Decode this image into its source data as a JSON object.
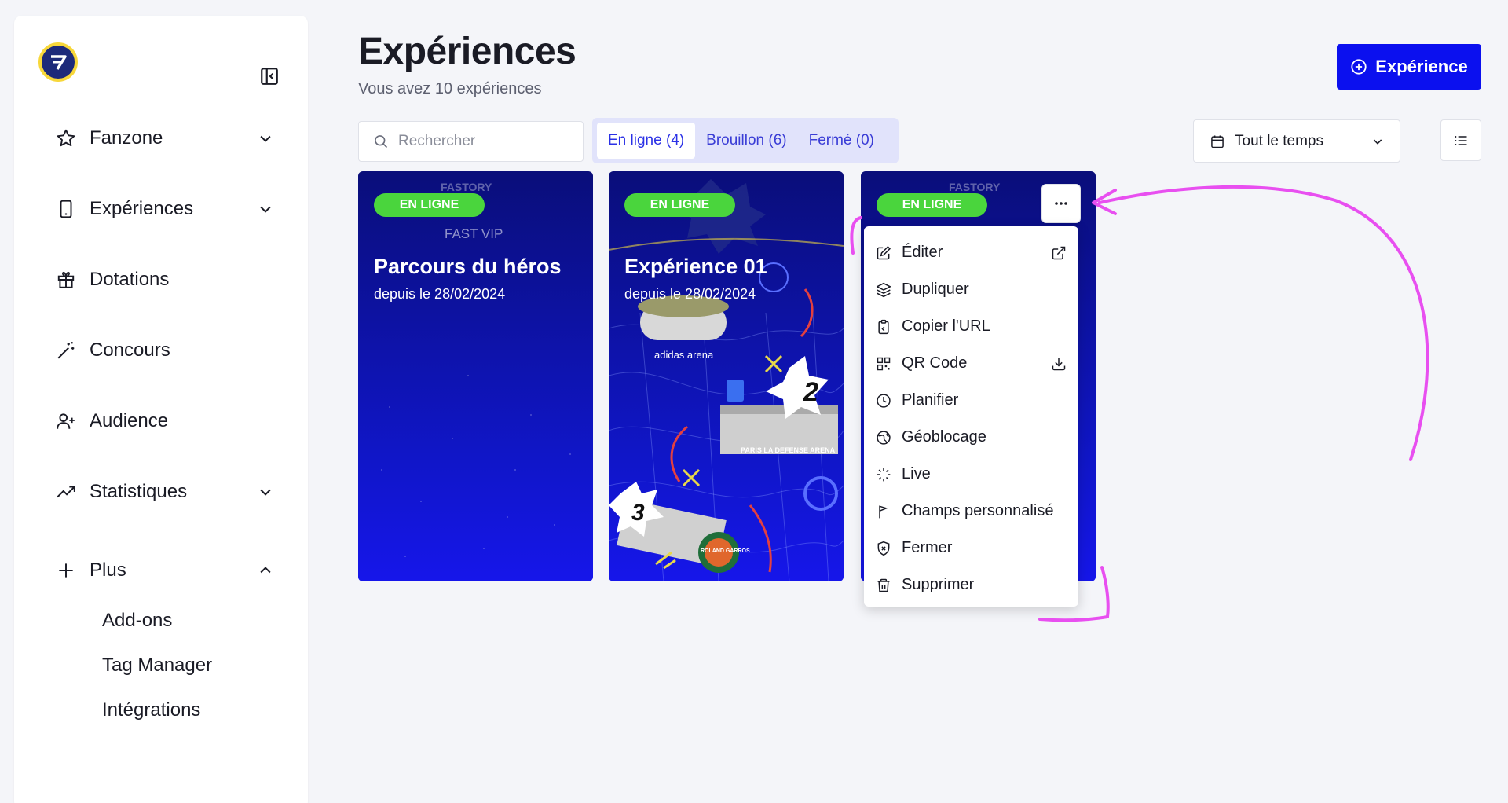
{
  "sidebar": {
    "items": [
      {
        "label": "Fanzone",
        "icon": "star-icon",
        "expandable": true
      },
      {
        "label": "Expériences",
        "icon": "smartphone-icon",
        "expandable": true
      },
      {
        "label": "Dotations",
        "icon": "gift-icon",
        "expandable": false
      },
      {
        "label": "Concours",
        "icon": "magic-wand-icon",
        "expandable": false
      },
      {
        "label": "Audience",
        "icon": "user-plus-icon",
        "expandable": false
      },
      {
        "label": "Statistiques",
        "icon": "trending-up-icon",
        "expandable": true
      },
      {
        "label": "Plus",
        "icon": "plus-icon",
        "expandable": true
      }
    ],
    "sub_items": [
      "Add-ons",
      "Tag Manager",
      "Intégrations"
    ]
  },
  "header": {
    "title": "Expériences",
    "subtitle": "Vous avez 10 expériences",
    "new_button": "Expérience"
  },
  "filters": {
    "search_placeholder": "Rechercher",
    "tabs": [
      "En ligne (4)",
      "Brouillon (6)",
      "Fermé (0)"
    ],
    "active_tab": "En ligne (4)",
    "date_range": "Tout le temps"
  },
  "cards": [
    {
      "status": "EN LIGNE",
      "title": "Parcours du héros",
      "date": "depuis le 28/02/2024",
      "brand": "FASTORY",
      "subtitle": "FAST VIP"
    },
    {
      "status": "EN LIGNE",
      "title": "Expérience 01",
      "date": "depuis le 28/02/2024",
      "venues": [
        "adidas arena",
        "PARIS LA DEFENSE ARENA",
        "ROLAND GARROS"
      ]
    },
    {
      "status": "EN LIGNE",
      "brand": "FASTORY"
    }
  ],
  "context_menu": {
    "items": [
      {
        "label": "Éditer",
        "icon": "edit-icon",
        "trailing": "external-link-icon"
      },
      {
        "label": "Dupliquer",
        "icon": "layers-icon"
      },
      {
        "label": "Copier l'URL",
        "icon": "clipboard-icon"
      },
      {
        "label": "QR Code",
        "icon": "qr-code-icon",
        "trailing": "download-icon"
      },
      {
        "label": "Planifier",
        "icon": "clock-icon"
      },
      {
        "label": "Géoblocage",
        "icon": "globe-icon"
      },
      {
        "label": "Live",
        "icon": "loader-icon"
      },
      {
        "label": "Champs personnalisé",
        "icon": "flag-icon"
      },
      {
        "label": "Fermer",
        "icon": "shield-x-icon"
      },
      {
        "label": "Supprimer",
        "icon": "trash-icon"
      }
    ]
  },
  "colors": {
    "primary": "#0b10ef",
    "badge_green": "#4ad53d",
    "annotation": "#e84ff0"
  }
}
